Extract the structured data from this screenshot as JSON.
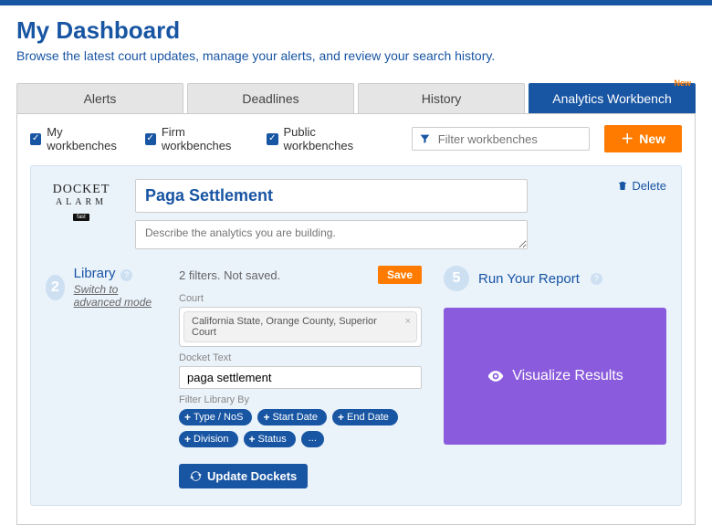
{
  "header": {
    "title": "My Dashboard",
    "subtitle": "Browse the latest court updates, manage your alerts, and review your search history."
  },
  "tabs": {
    "alerts": "Alerts",
    "deadlines": "Deadlines",
    "history": "History",
    "analytics": "Analytics Workbench",
    "analytics_badge": "New"
  },
  "toolbar": {
    "my_workbenches": "My workbenches",
    "firm_workbenches": "Firm workbenches",
    "public_workbenches": "Public workbenches",
    "filter_placeholder": "Filter workbenches",
    "new_button": "New"
  },
  "workbench": {
    "logo_line1": "DOCKET",
    "logo_line2": "ALARM",
    "title_value": "Paga Settlement",
    "desc_placeholder": "Describe the analytics you are building.",
    "delete_label": "Delete"
  },
  "library": {
    "step_num": "2",
    "title": "Library",
    "switch_link": "Switch to advanced mode",
    "filters_status": "2 filters. Not saved.",
    "save_label": "Save",
    "court_label": "Court",
    "court_value": "California State, Orange County, Superior Court",
    "docket_text_label": "Docket Text",
    "docket_text_value": "paga settlement",
    "filter_by_label": "Filter Library By",
    "chips": {
      "type": "Type / NoS",
      "start": "Start Date",
      "end": "End Date",
      "division": "Division",
      "status": "Status",
      "more": "..."
    },
    "update_dockets": "Update Dockets"
  },
  "report": {
    "step_num": "5",
    "title": "Run Your Report",
    "viz_label": "Visualize Results"
  }
}
